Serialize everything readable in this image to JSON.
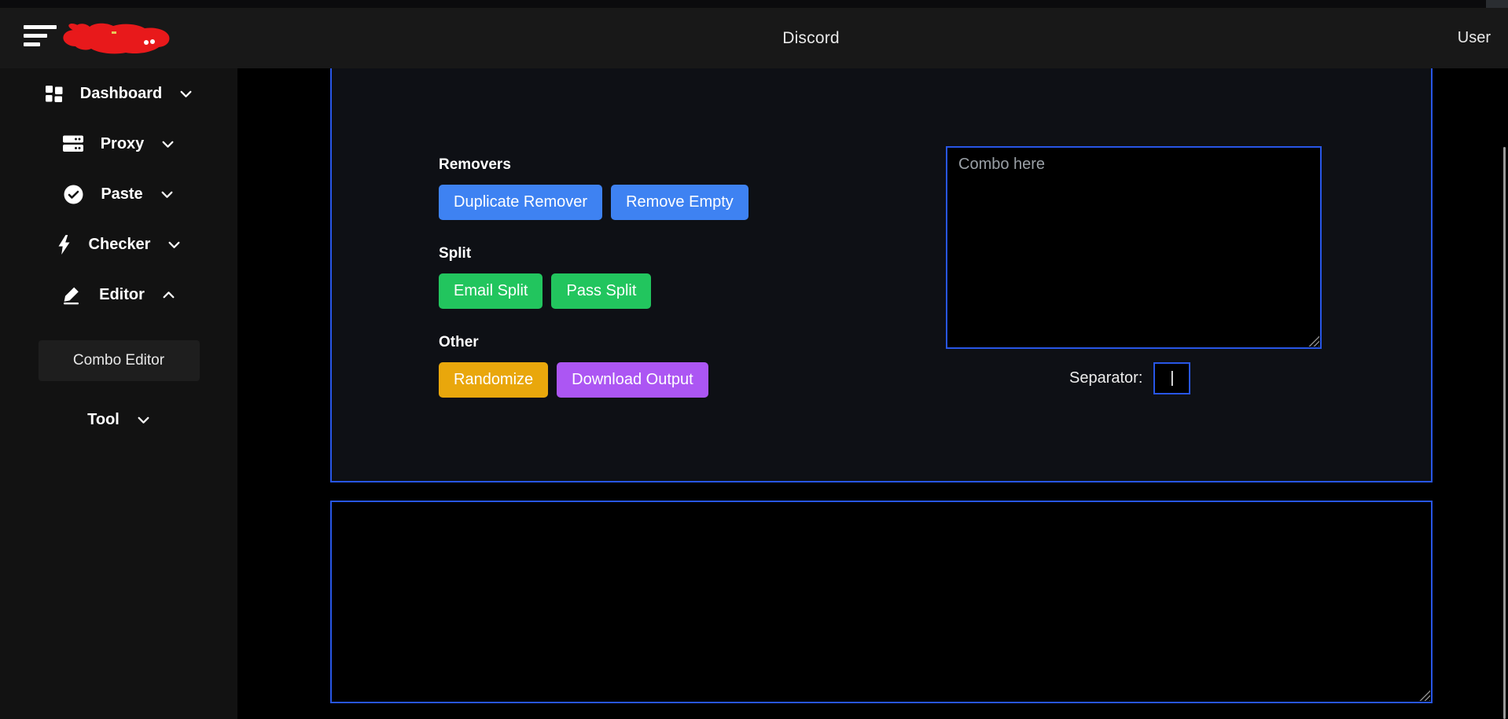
{
  "topbar": {
    "title": "Discord",
    "user": "User"
  },
  "sidebar": {
    "items": [
      {
        "label": "Dashboard",
        "icon": "dashboard-grid-icon",
        "chevron": "down"
      },
      {
        "label": "Proxy",
        "icon": "server-stack-icon",
        "chevron": "down"
      },
      {
        "label": "Paste",
        "icon": "check-circle-icon",
        "chevron": "down"
      },
      {
        "label": "Checker",
        "icon": "lightning-bolt-icon",
        "chevron": "down"
      },
      {
        "label": "Editor",
        "icon": "pencil-icon",
        "chevron": "up",
        "expanded": true
      },
      {
        "label": "Tool",
        "icon": "none",
        "chevron": "down"
      }
    ],
    "submenu": {
      "label": "Combo Editor",
      "active": true
    }
  },
  "editor": {
    "sections": [
      {
        "title": "Removers",
        "buttons": [
          {
            "label": "Duplicate Remover"
          },
          {
            "label": "Remove Empty"
          }
        ]
      },
      {
        "title": "Split",
        "buttons": [
          {
            "label": "Email Split"
          },
          {
            "label": "Pass Split"
          }
        ]
      },
      {
        "title": "Other",
        "buttons": [
          {
            "label": "Randomize"
          },
          {
            "label": "Download Output"
          }
        ]
      }
    ],
    "combo_input": {
      "placeholder": "Combo here",
      "value": ""
    },
    "separator": {
      "label": "Separator:",
      "value": "|"
    },
    "output": {
      "value": ""
    }
  },
  "colors": {
    "accent_border": "#2856e6",
    "primary_button": "#3e82f2",
    "success_button": "#22c55e",
    "warning_button": "#e9a70c",
    "purple_button": "#ac56f3",
    "brand_scribble": "#e8191b",
    "header_bg": "#181818",
    "sidebar_bg": "#121212",
    "panel_bg": "#0e1015"
  }
}
